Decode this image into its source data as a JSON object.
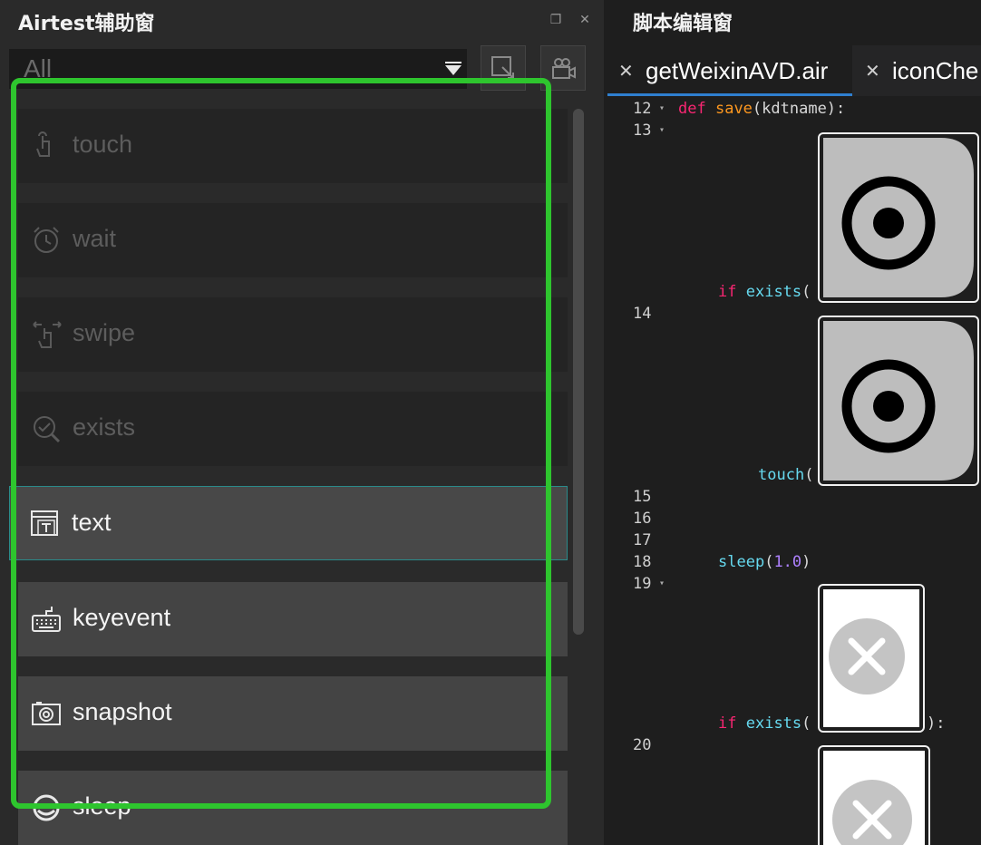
{
  "left_panel": {
    "title": "Airtest辅助窗",
    "filter": {
      "value": "All"
    },
    "items": [
      {
        "label": "touch",
        "state": "disabled",
        "icon": "hand-pointer-icon"
      },
      {
        "label": "wait",
        "state": "disabled",
        "icon": "alarm-clock-icon"
      },
      {
        "label": "swipe",
        "state": "disabled",
        "icon": "swipe-hand-icon"
      },
      {
        "label": "exists",
        "state": "disabled",
        "icon": "magnifier-check-icon"
      },
      {
        "label": "text",
        "state": "selected",
        "icon": "text-box-icon"
      },
      {
        "label": "keyevent",
        "state": "enabled",
        "icon": "keyboard-icon"
      },
      {
        "label": "snapshot",
        "state": "enabled",
        "icon": "camera-icon"
      },
      {
        "label": "sleep",
        "state": "enabled",
        "icon": "sleep-clock-icon"
      }
    ],
    "highlight_color": "#2ec52e"
  },
  "right_panel": {
    "title": "脚本编辑窗",
    "tabs": [
      {
        "label": "getWeixinAVD.air",
        "active": true
      },
      {
        "label": "iconChe",
        "active": false
      }
    ],
    "code": {
      "line12_no": "12",
      "line12_kw": "def",
      "line12_fn": "save",
      "line12_rest": "(kdtname):",
      "line13_no": "13",
      "line13_kw": "if",
      "line13_call": "exists",
      "line13_paren": "(",
      "line14_no": "14",
      "line14_call": "touch",
      "line14_paren": "(",
      "line15_no": "15",
      "line16_no": "16",
      "line17_no": "17",
      "line18_no": "18",
      "line18_call": "sleep",
      "line18_num": "1.0",
      "line19_no": "19",
      "line19_kw": "if",
      "line19_call": "exists",
      "line19_open": "(",
      "line19_close": "):",
      "line20_no": "20",
      "lparen": "(",
      "rparen": ")"
    }
  }
}
